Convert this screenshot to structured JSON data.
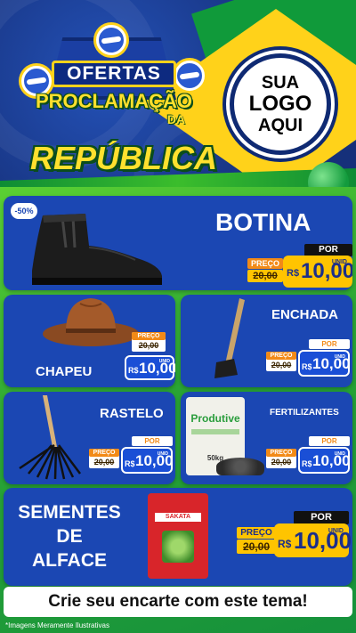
{
  "header": {
    "title_line1": "OFERTAS",
    "title_line2": "PROCLAMAÇÃO",
    "title_line3": "DA",
    "title_line4": "REPÚBLICA",
    "logo_line1": "SUA",
    "logo_line2": "LOGO",
    "logo_line3": "AQUI"
  },
  "price_labels": {
    "preco": "PREÇO",
    "por": "POR",
    "currency": "R$",
    "unit": "UNID"
  },
  "products": {
    "botina": {
      "name": "BOTINA",
      "discount": "-50%",
      "old": "20,00",
      "price": "10,00"
    },
    "chapeu": {
      "name": "CHAPEU",
      "old": "20,00",
      "price": "10,00"
    },
    "enchada": {
      "name": "ENCHADA",
      "old": "20,00",
      "price": "10,00"
    },
    "rastelo": {
      "name": "RASTELO",
      "old": "20,00",
      "price": "10,00"
    },
    "fertilizantes": {
      "name": "FERTILIZANTES",
      "bag_label": "Produtive",
      "bag_weight": "50kg",
      "old": "20,00",
      "price": "10,00"
    },
    "sementes": {
      "name_line1": "SEMENTES",
      "name_line2": "DE",
      "name_line3": "ALFACE",
      "brand": "SAKATA",
      "old": "20,00",
      "price": "10,00"
    }
  },
  "banner": {
    "text": "Crie seu encarte com este tema!"
  },
  "footnote": "*Imagens Meramente Ilustrativas",
  "colors": {
    "header_blue": "#16307a",
    "card_blue": "#1b47b3",
    "flag_green": "#109a3a",
    "flag_yellow": "#ffd21a",
    "price_yellow": "#ffc400",
    "preco_orange": "#f28a17"
  }
}
